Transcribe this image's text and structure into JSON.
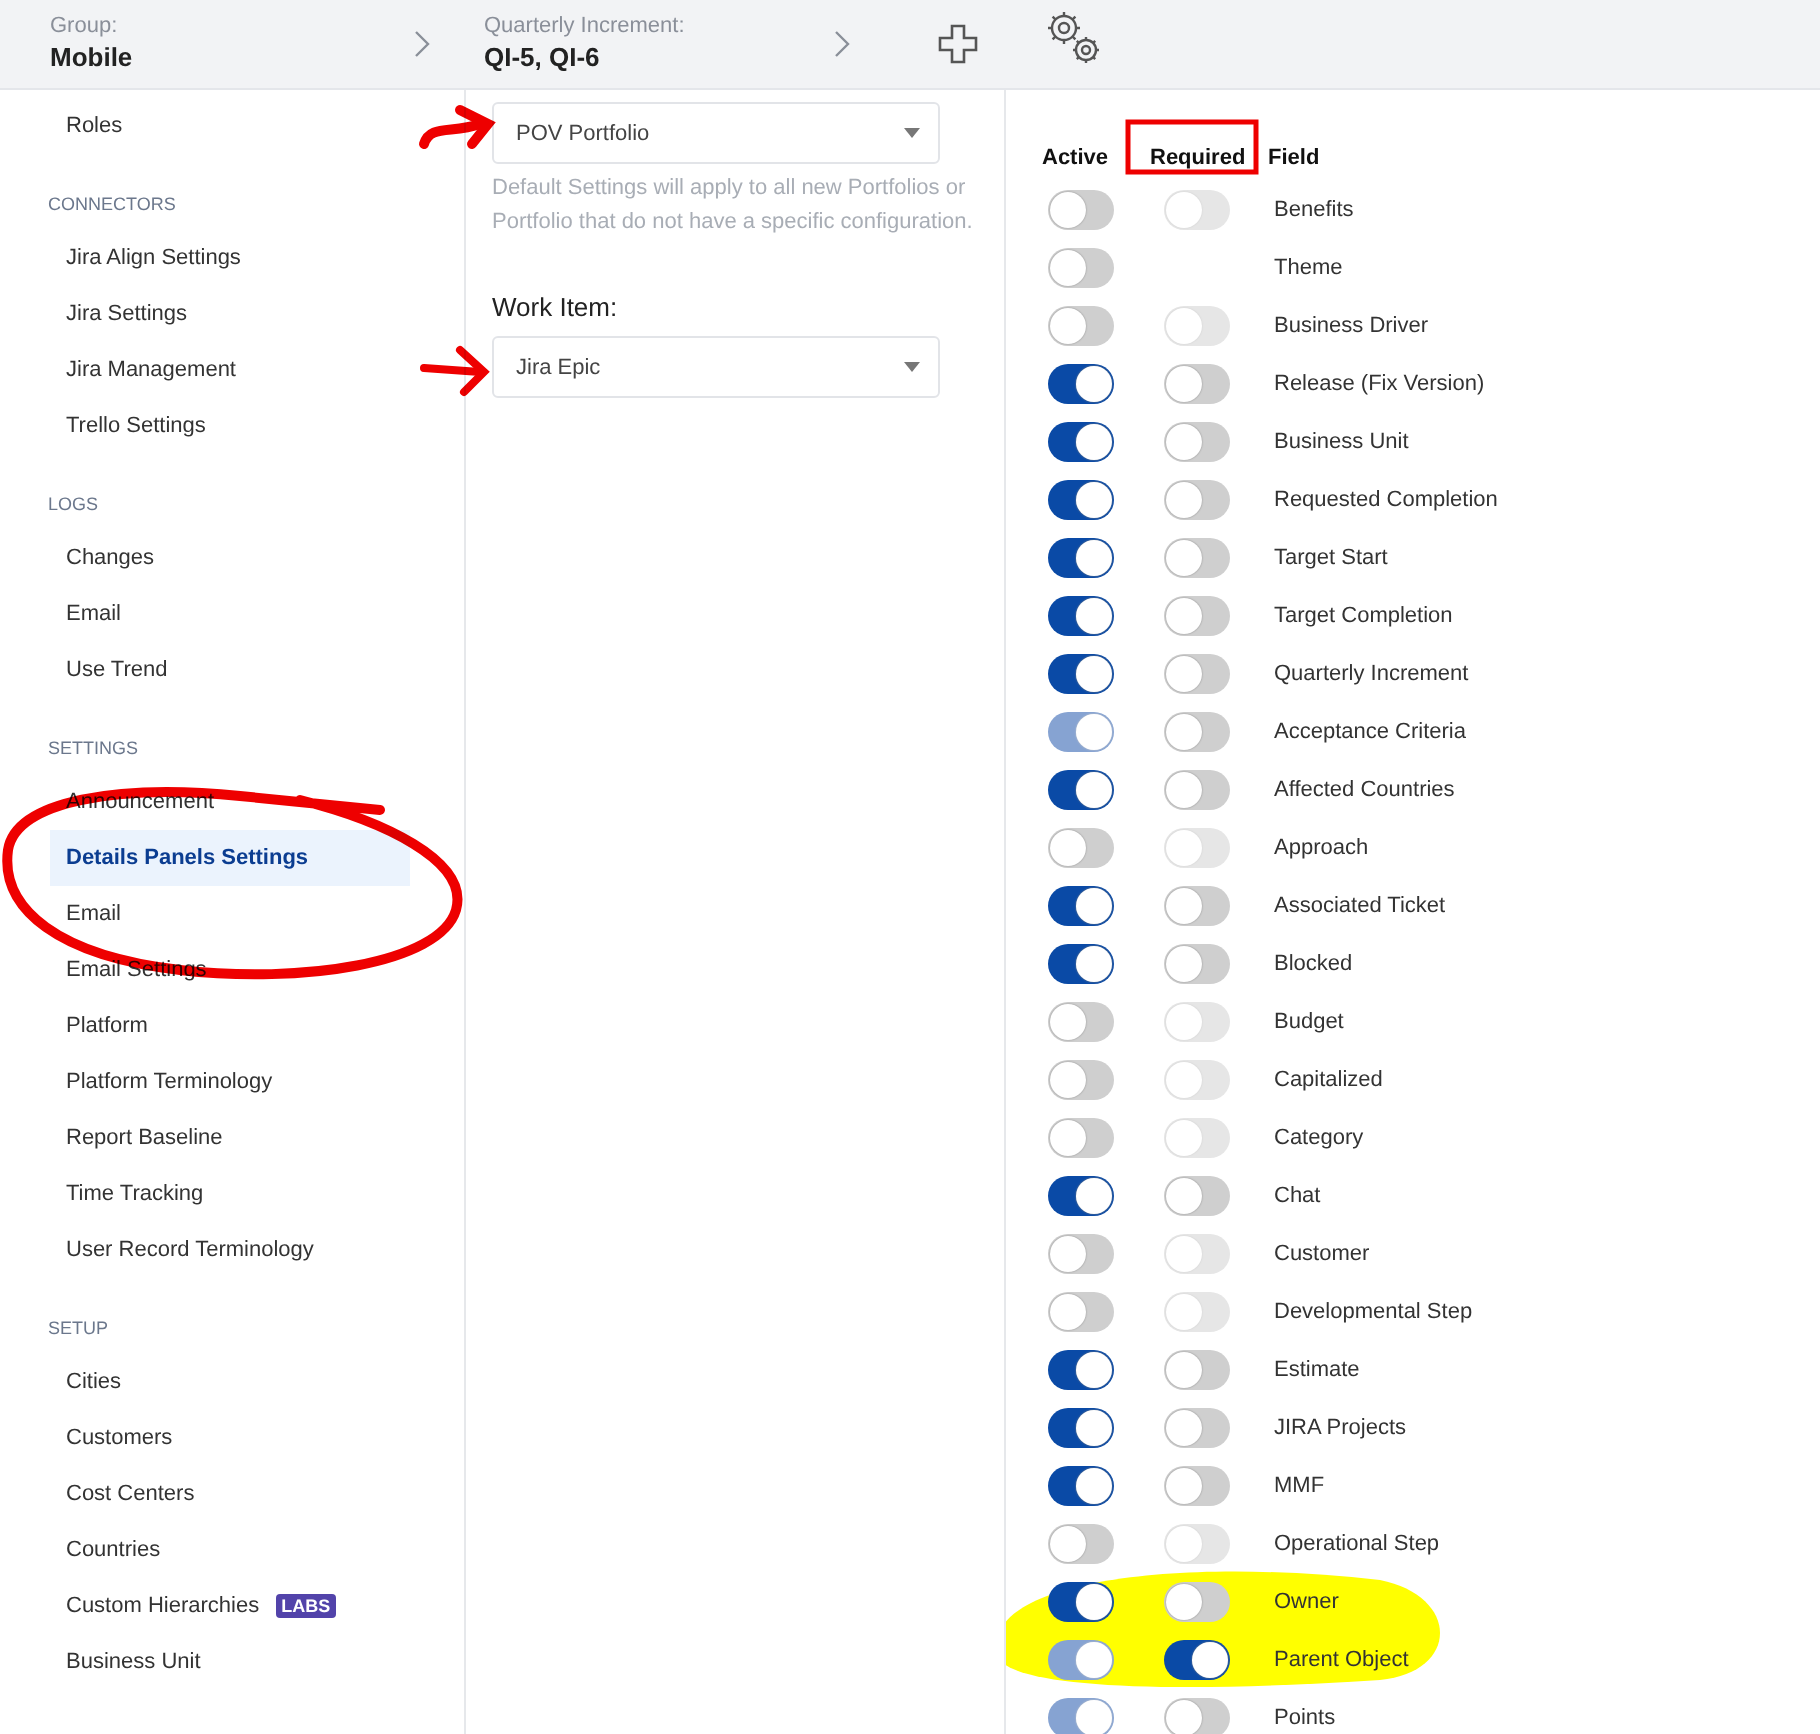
{
  "header": {
    "group": {
      "label": "Group:",
      "value": "Mobile"
    },
    "increment": {
      "label": "Quarterly Increment:",
      "value": "QI-5, QI-6"
    }
  },
  "sidebar": [
    {
      "items": [
        {
          "label": "Roles",
          "selected": false
        }
      ]
    },
    {
      "heading": "CONNECTORS",
      "items": [
        {
          "label": "Jira Align Settings",
          "selected": false
        },
        {
          "label": "Jira Settings",
          "selected": false
        },
        {
          "label": "Jira Management",
          "selected": false
        },
        {
          "label": "Trello Settings",
          "selected": false
        }
      ]
    },
    {
      "heading": "LOGS",
      "items": [
        {
          "label": "Changes",
          "selected": false
        },
        {
          "label": "Email",
          "selected": false
        },
        {
          "label": "Use Trend",
          "selected": false
        }
      ]
    },
    {
      "heading": "SETTINGS",
      "items": [
        {
          "label": "Announcement",
          "selected": false
        },
        {
          "label": "Details Panels Settings",
          "selected": true
        },
        {
          "label": "Email",
          "selected": false
        },
        {
          "label": "Email Settings",
          "selected": false
        },
        {
          "label": "Platform",
          "selected": false
        },
        {
          "label": "Platform Terminology",
          "selected": false
        },
        {
          "label": "Report Baseline",
          "selected": false
        },
        {
          "label": "Time Tracking",
          "selected": false
        },
        {
          "label": "User Record Terminology",
          "selected": false
        }
      ]
    },
    {
      "heading": "SETUP",
      "items": [
        {
          "label": "Cities",
          "selected": false
        },
        {
          "label": "Customers",
          "selected": false
        },
        {
          "label": "Cost Centers",
          "selected": false
        },
        {
          "label": "Countries",
          "selected": false
        },
        {
          "label": "Custom Hierarchies",
          "selected": false,
          "badge": "LABS"
        },
        {
          "label": "Business Unit",
          "selected": false
        }
      ]
    }
  ],
  "portfolio": {
    "value": "POV Portfolio",
    "hint": "Default Settings will apply to all new Portfolios or Portfolio that do not have a specific configuration."
  },
  "work_item": {
    "label": "Work Item:",
    "value": "Jira Epic"
  },
  "columns": [
    "Active",
    "Required",
    "Field"
  ],
  "fields": [
    {
      "name": "Benefits",
      "active": {
        "on": false,
        "disabled": false
      },
      "required": {
        "on": false,
        "disabled": true
      }
    },
    {
      "name": "Theme",
      "active": {
        "on": false,
        "disabled": false
      }
    },
    {
      "name": "Business Driver",
      "active": {
        "on": false,
        "disabled": false
      },
      "required": {
        "on": false,
        "disabled": true
      }
    },
    {
      "name": "Release (Fix Version)",
      "active": {
        "on": true,
        "disabled": false
      },
      "required": {
        "on": false,
        "disabled": false
      }
    },
    {
      "name": "Business Unit",
      "active": {
        "on": true,
        "disabled": false
      },
      "required": {
        "on": false,
        "disabled": false
      }
    },
    {
      "name": "Requested Completion",
      "active": {
        "on": true,
        "disabled": false
      },
      "required": {
        "on": false,
        "disabled": false
      }
    },
    {
      "name": "Target Start",
      "active": {
        "on": true,
        "disabled": false
      },
      "required": {
        "on": false,
        "disabled": false
      }
    },
    {
      "name": "Target Completion",
      "active": {
        "on": true,
        "disabled": false
      },
      "required": {
        "on": false,
        "disabled": false
      }
    },
    {
      "name": "Quarterly Increment",
      "active": {
        "on": true,
        "disabled": false
      },
      "required": {
        "on": false,
        "disabled": false
      }
    },
    {
      "name": "Acceptance Criteria",
      "active": {
        "on": true,
        "disabled": true
      },
      "required": {
        "on": false,
        "disabled": false
      }
    },
    {
      "name": "Affected Countries",
      "active": {
        "on": true,
        "disabled": false
      },
      "required": {
        "on": false,
        "disabled": false
      }
    },
    {
      "name": "Approach",
      "active": {
        "on": false,
        "disabled": false
      },
      "required": {
        "on": false,
        "disabled": true
      }
    },
    {
      "name": "Associated Ticket",
      "active": {
        "on": true,
        "disabled": false
      },
      "required": {
        "on": false,
        "disabled": false
      }
    },
    {
      "name": "Blocked",
      "active": {
        "on": true,
        "disabled": false
      },
      "required": {
        "on": false,
        "disabled": false
      }
    },
    {
      "name": "Budget",
      "active": {
        "on": false,
        "disabled": false
      },
      "required": {
        "on": false,
        "disabled": true
      }
    },
    {
      "name": "Capitalized",
      "active": {
        "on": false,
        "disabled": false
      },
      "required": {
        "on": false,
        "disabled": true
      }
    },
    {
      "name": "Category",
      "active": {
        "on": false,
        "disabled": false
      },
      "required": {
        "on": false,
        "disabled": true
      }
    },
    {
      "name": "Chat",
      "active": {
        "on": true,
        "disabled": false
      },
      "required": {
        "on": false,
        "disabled": false
      }
    },
    {
      "name": "Customer",
      "active": {
        "on": false,
        "disabled": false
      },
      "required": {
        "on": false,
        "disabled": true
      }
    },
    {
      "name": "Developmental Step",
      "active": {
        "on": false,
        "disabled": false
      },
      "required": {
        "on": false,
        "disabled": true
      }
    },
    {
      "name": "Estimate",
      "active": {
        "on": true,
        "disabled": false
      },
      "required": {
        "on": false,
        "disabled": false
      }
    },
    {
      "name": "JIRA Projects",
      "active": {
        "on": true,
        "disabled": false
      },
      "required": {
        "on": false,
        "disabled": false
      }
    },
    {
      "name": "MMF",
      "active": {
        "on": true,
        "disabled": false
      },
      "required": {
        "on": false,
        "disabled": false
      }
    },
    {
      "name": "Operational Step",
      "active": {
        "on": false,
        "disabled": false
      },
      "required": {
        "on": false,
        "disabled": true
      }
    },
    {
      "name": "Owner",
      "active": {
        "on": true,
        "disabled": false
      },
      "required": {
        "on": false,
        "disabled": false
      }
    },
    {
      "name": "Parent Object",
      "active": {
        "on": true,
        "disabled": true
      },
      "required": {
        "on": true,
        "disabled": false
      }
    },
    {
      "name": "Points",
      "active": {
        "on": true,
        "disabled": true
      },
      "required": {
        "on": false,
        "disabled": false
      }
    }
  ]
}
